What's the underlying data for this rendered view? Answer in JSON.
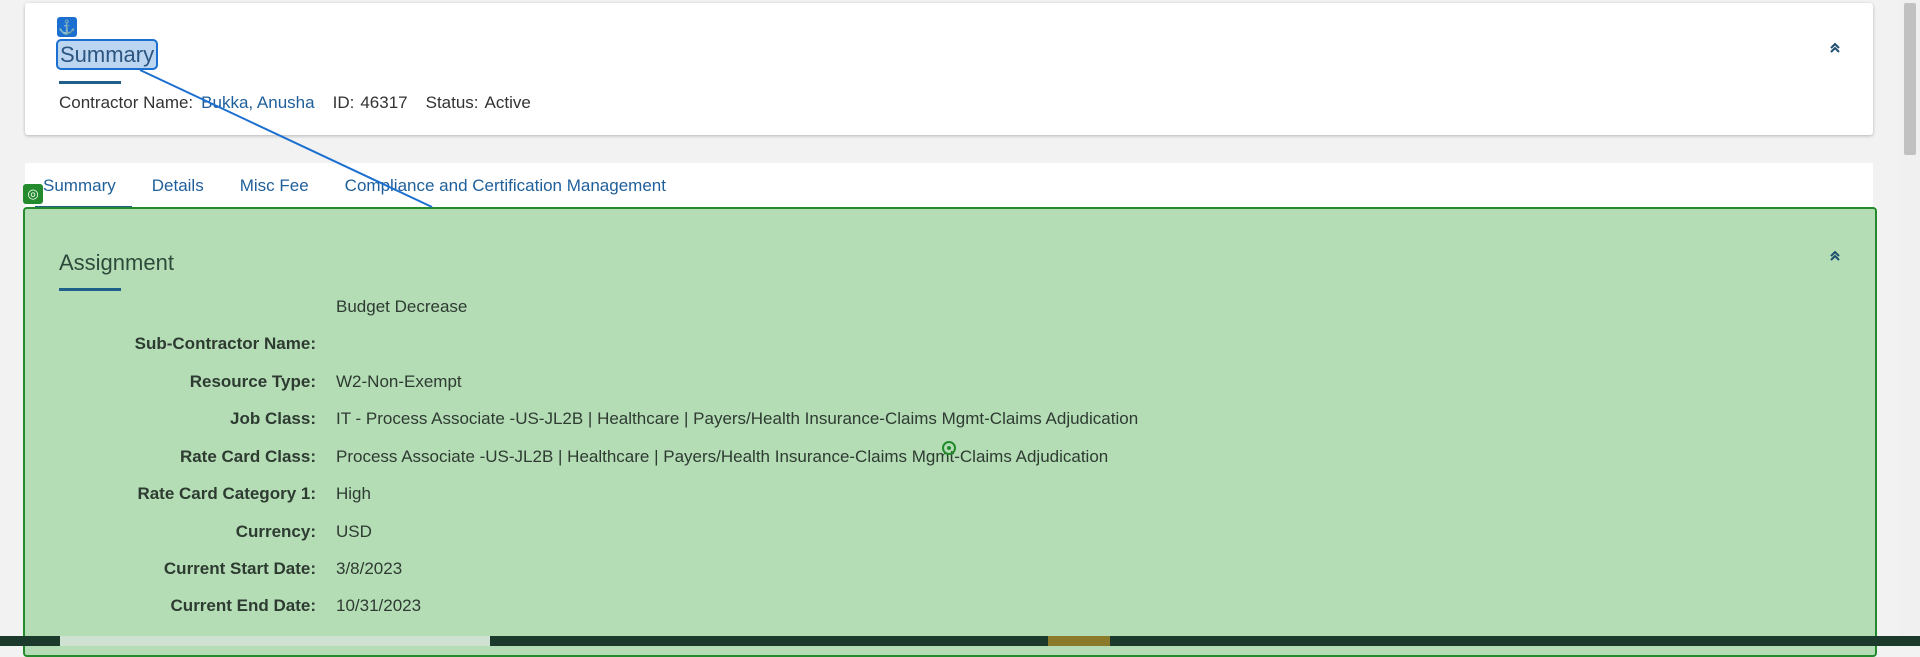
{
  "header": {
    "anchor_icon": "anchor-icon",
    "title": "Summary",
    "collapse_icon": "chevron-double-up-icon",
    "contractor_label": "Contractor Name:",
    "contractor_name": "Bukka, Anusha",
    "id_label": "ID:",
    "id_value": "46317",
    "status_label": "Status:",
    "status_value": "Active"
  },
  "tabs": [
    {
      "label": "Summary",
      "active": true
    },
    {
      "label": "Details",
      "active": false
    },
    {
      "label": "Misc Fee",
      "active": false
    },
    {
      "label": "Compliance and Certification Management",
      "active": false
    }
  ],
  "assignment": {
    "title": "Assignment",
    "collapse_icon": "chevron-double-up-icon",
    "rows": [
      {
        "label": "",
        "value": "Budget Decrease"
      },
      {
        "label": "Sub-Contractor Name:",
        "value": ""
      },
      {
        "label": "Resource Type:",
        "value": "W2-Non-Exempt"
      },
      {
        "label": "Job Class:",
        "value": "IT - Process Associate -US-JL2B | Healthcare | Payers/Health Insurance-Claims Mgmt-Claims Adjudication"
      },
      {
        "label": "Rate Card Class:",
        "value": "Process Associate -US-JL2B | Healthcare | Payers/Health Insurance-Claims Mgmt-Claims Adjudication"
      },
      {
        "label": "Rate Card Category 1:",
        "value": "High"
      },
      {
        "label": "Currency:",
        "value": "USD"
      },
      {
        "label": "Current Start Date:",
        "value": "3/8/2023"
      },
      {
        "label": "Current End Date:",
        "value": "10/31/2023"
      }
    ]
  },
  "colors": {
    "accent": "#1a6fd0",
    "panel_bg": "#b4ddb6",
    "panel_border": "#238b2d",
    "link": "#1f5f9a"
  }
}
